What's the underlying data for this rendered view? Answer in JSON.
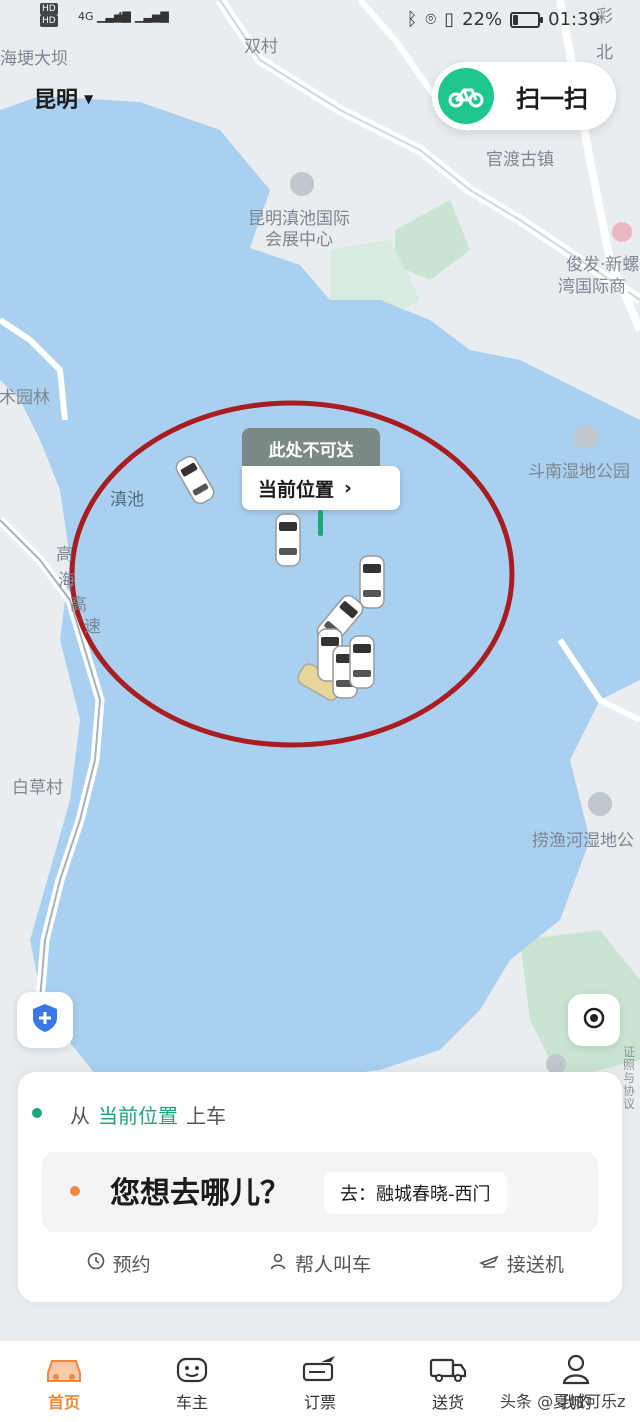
{
  "status_bar": {
    "hd_badge": "HD",
    "signal_label": "4G",
    "battery_percent": 22,
    "battery_label": "22%",
    "time": "01:39"
  },
  "header": {
    "city": "昆明",
    "scan_label": "扫一扫"
  },
  "map": {
    "labels": [
      "海埂大坝",
      "双村",
      "官渡古镇",
      "昆明滇池国际",
      "会展中心",
      "俊发·新螺",
      "湾国际商",
      "艺术园林",
      "斗南湿地公园",
      "滇池",
      "高",
      "海",
      "高",
      "速",
      "白草村",
      "捞渔河湿地公",
      "彩",
      "北"
    ],
    "unreachable_tip": "此处不可达",
    "current_location": "当前位置",
    "legal_text": "证照与协议",
    "colors": {
      "water": "#a9d0ef",
      "land": "#e9edef",
      "green": "#c9e5d2",
      "road": "#ffffff",
      "circle": "#a81c22"
    }
  },
  "card": {
    "pickup_prefix": "从",
    "pickup_location": "当前位置",
    "pickup_suffix": "上车",
    "destination_prompt": "您想去哪儿？",
    "destination_suggestion": "去：融城春晓-西门",
    "options": [
      "预约",
      "帮人叫车",
      "接送机"
    ]
  },
  "tabs": [
    {
      "label": "首页",
      "icon": "car-home-icon",
      "active": true
    },
    {
      "label": "车主",
      "icon": "driver-face-icon",
      "active": false
    },
    {
      "label": "订票",
      "icon": "ticket-plane-icon",
      "active": false
    },
    {
      "label": "送货",
      "icon": "delivery-truck-icon",
      "active": false
    },
    {
      "label": "我的",
      "icon": "profile-icon",
      "active": false
    }
  ],
  "watermark": "头条 @夏城可乐z"
}
